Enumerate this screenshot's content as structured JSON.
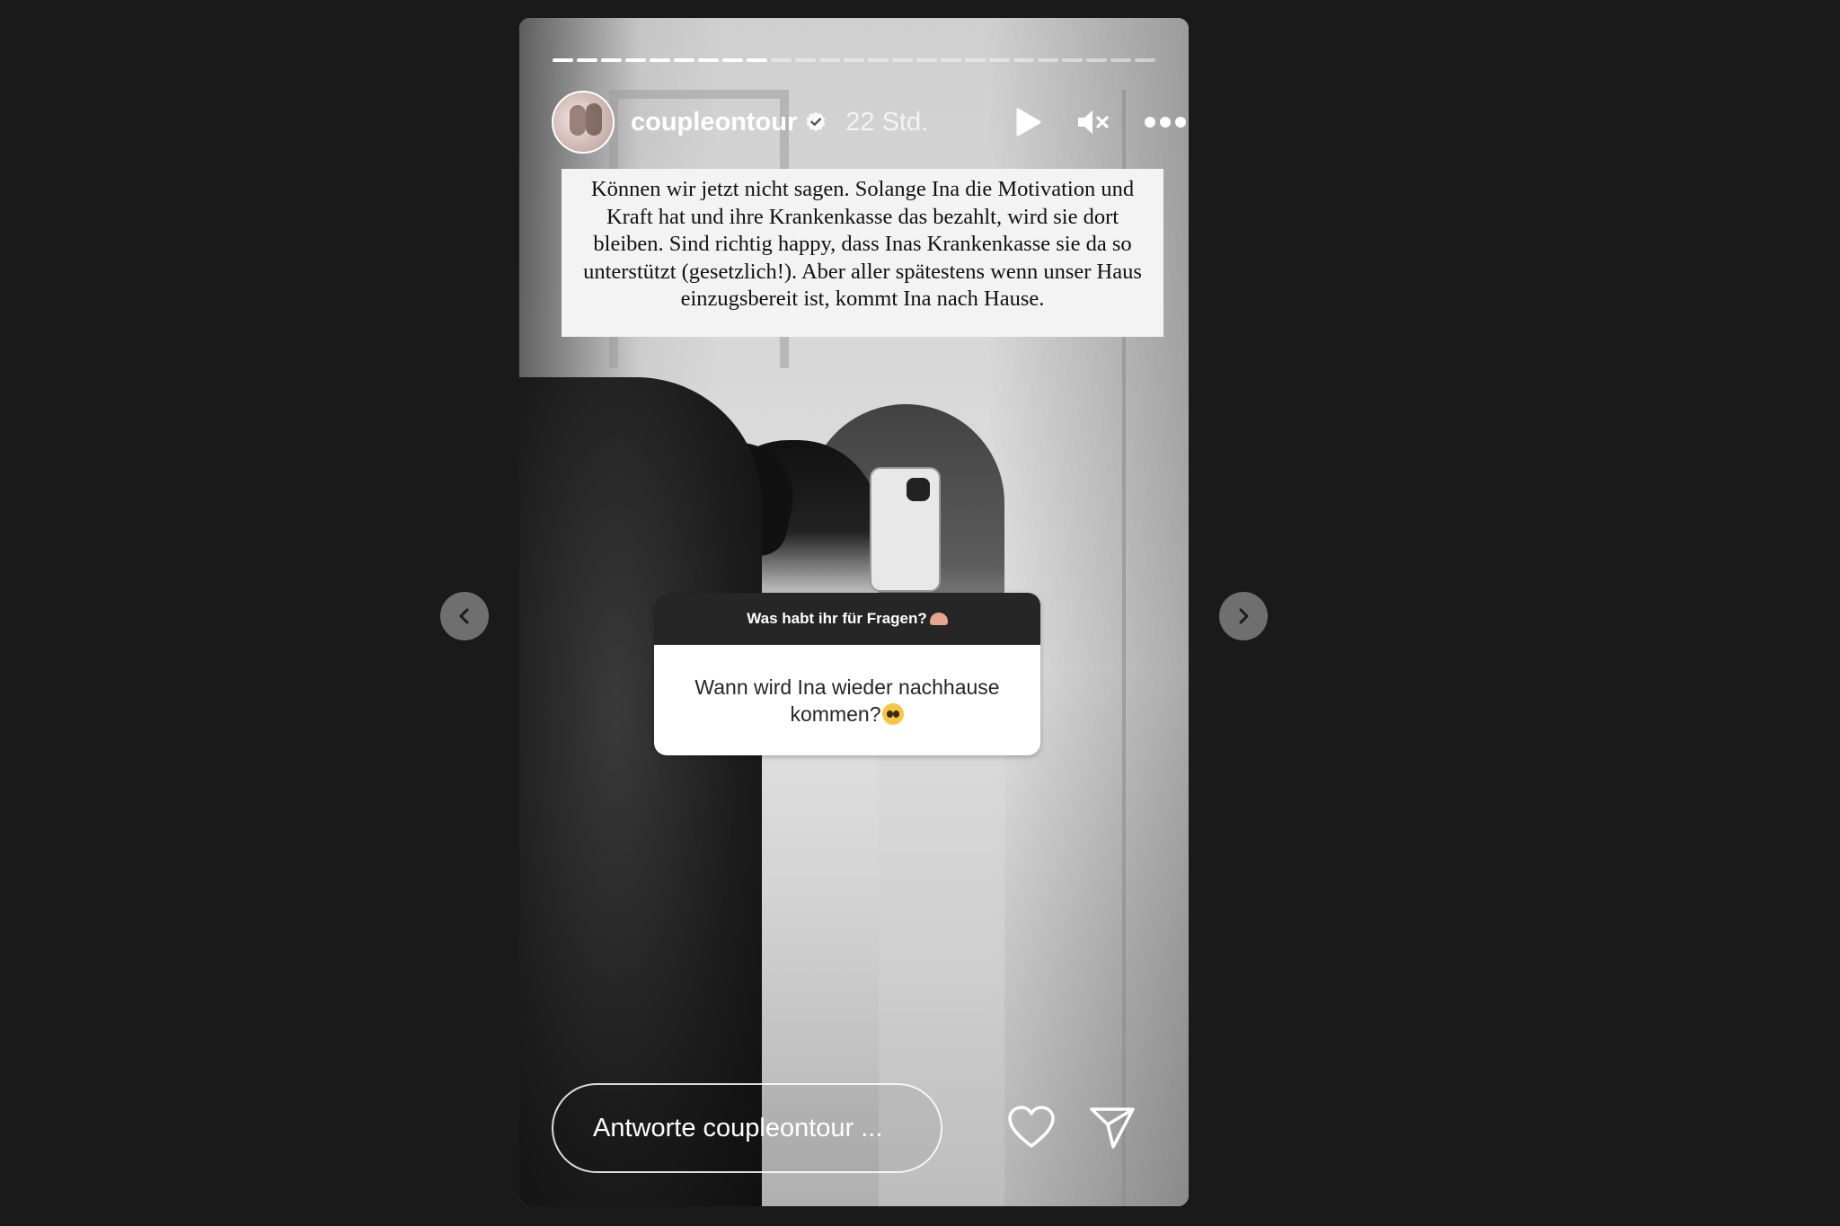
{
  "story": {
    "progress": {
      "total_segments": 25,
      "completed_segments": 9
    },
    "header": {
      "username": "coupleontour",
      "verified": true,
      "time": "22 Std."
    },
    "answer_text": "Können wir jetzt nicht sagen. Solange Ina die Motivation und Kraft hat und ihre Krankenkasse das bezahlt, wird sie dort bleiben. Sind richtig happy, dass Inas Krankenkasse sie da so unterstützt (gesetzlich!). Aber aller spätestens wenn unser Haus einzugsbereit ist, kommt Ina nach Hause.",
    "question_sticker": {
      "prompt": "Was habt ihr für Fragen?",
      "question": "Wann wird Ina wieder nachhause kommen?"
    },
    "reply": {
      "placeholder": "Antworte coupleontour ..."
    },
    "icons": {
      "play": "play-icon",
      "mute": "muted-speaker-icon",
      "more": "more-dots-icon",
      "like": "heart-icon",
      "send": "send-paper-plane-icon",
      "prev": "chevron-left-icon",
      "next": "chevron-right-icon"
    }
  },
  "colors": {
    "background": "#1a1a1a",
    "sticker_header": "#262626",
    "text_box": "#f3f3f3",
    "nav_button": "#6f6f6f"
  }
}
